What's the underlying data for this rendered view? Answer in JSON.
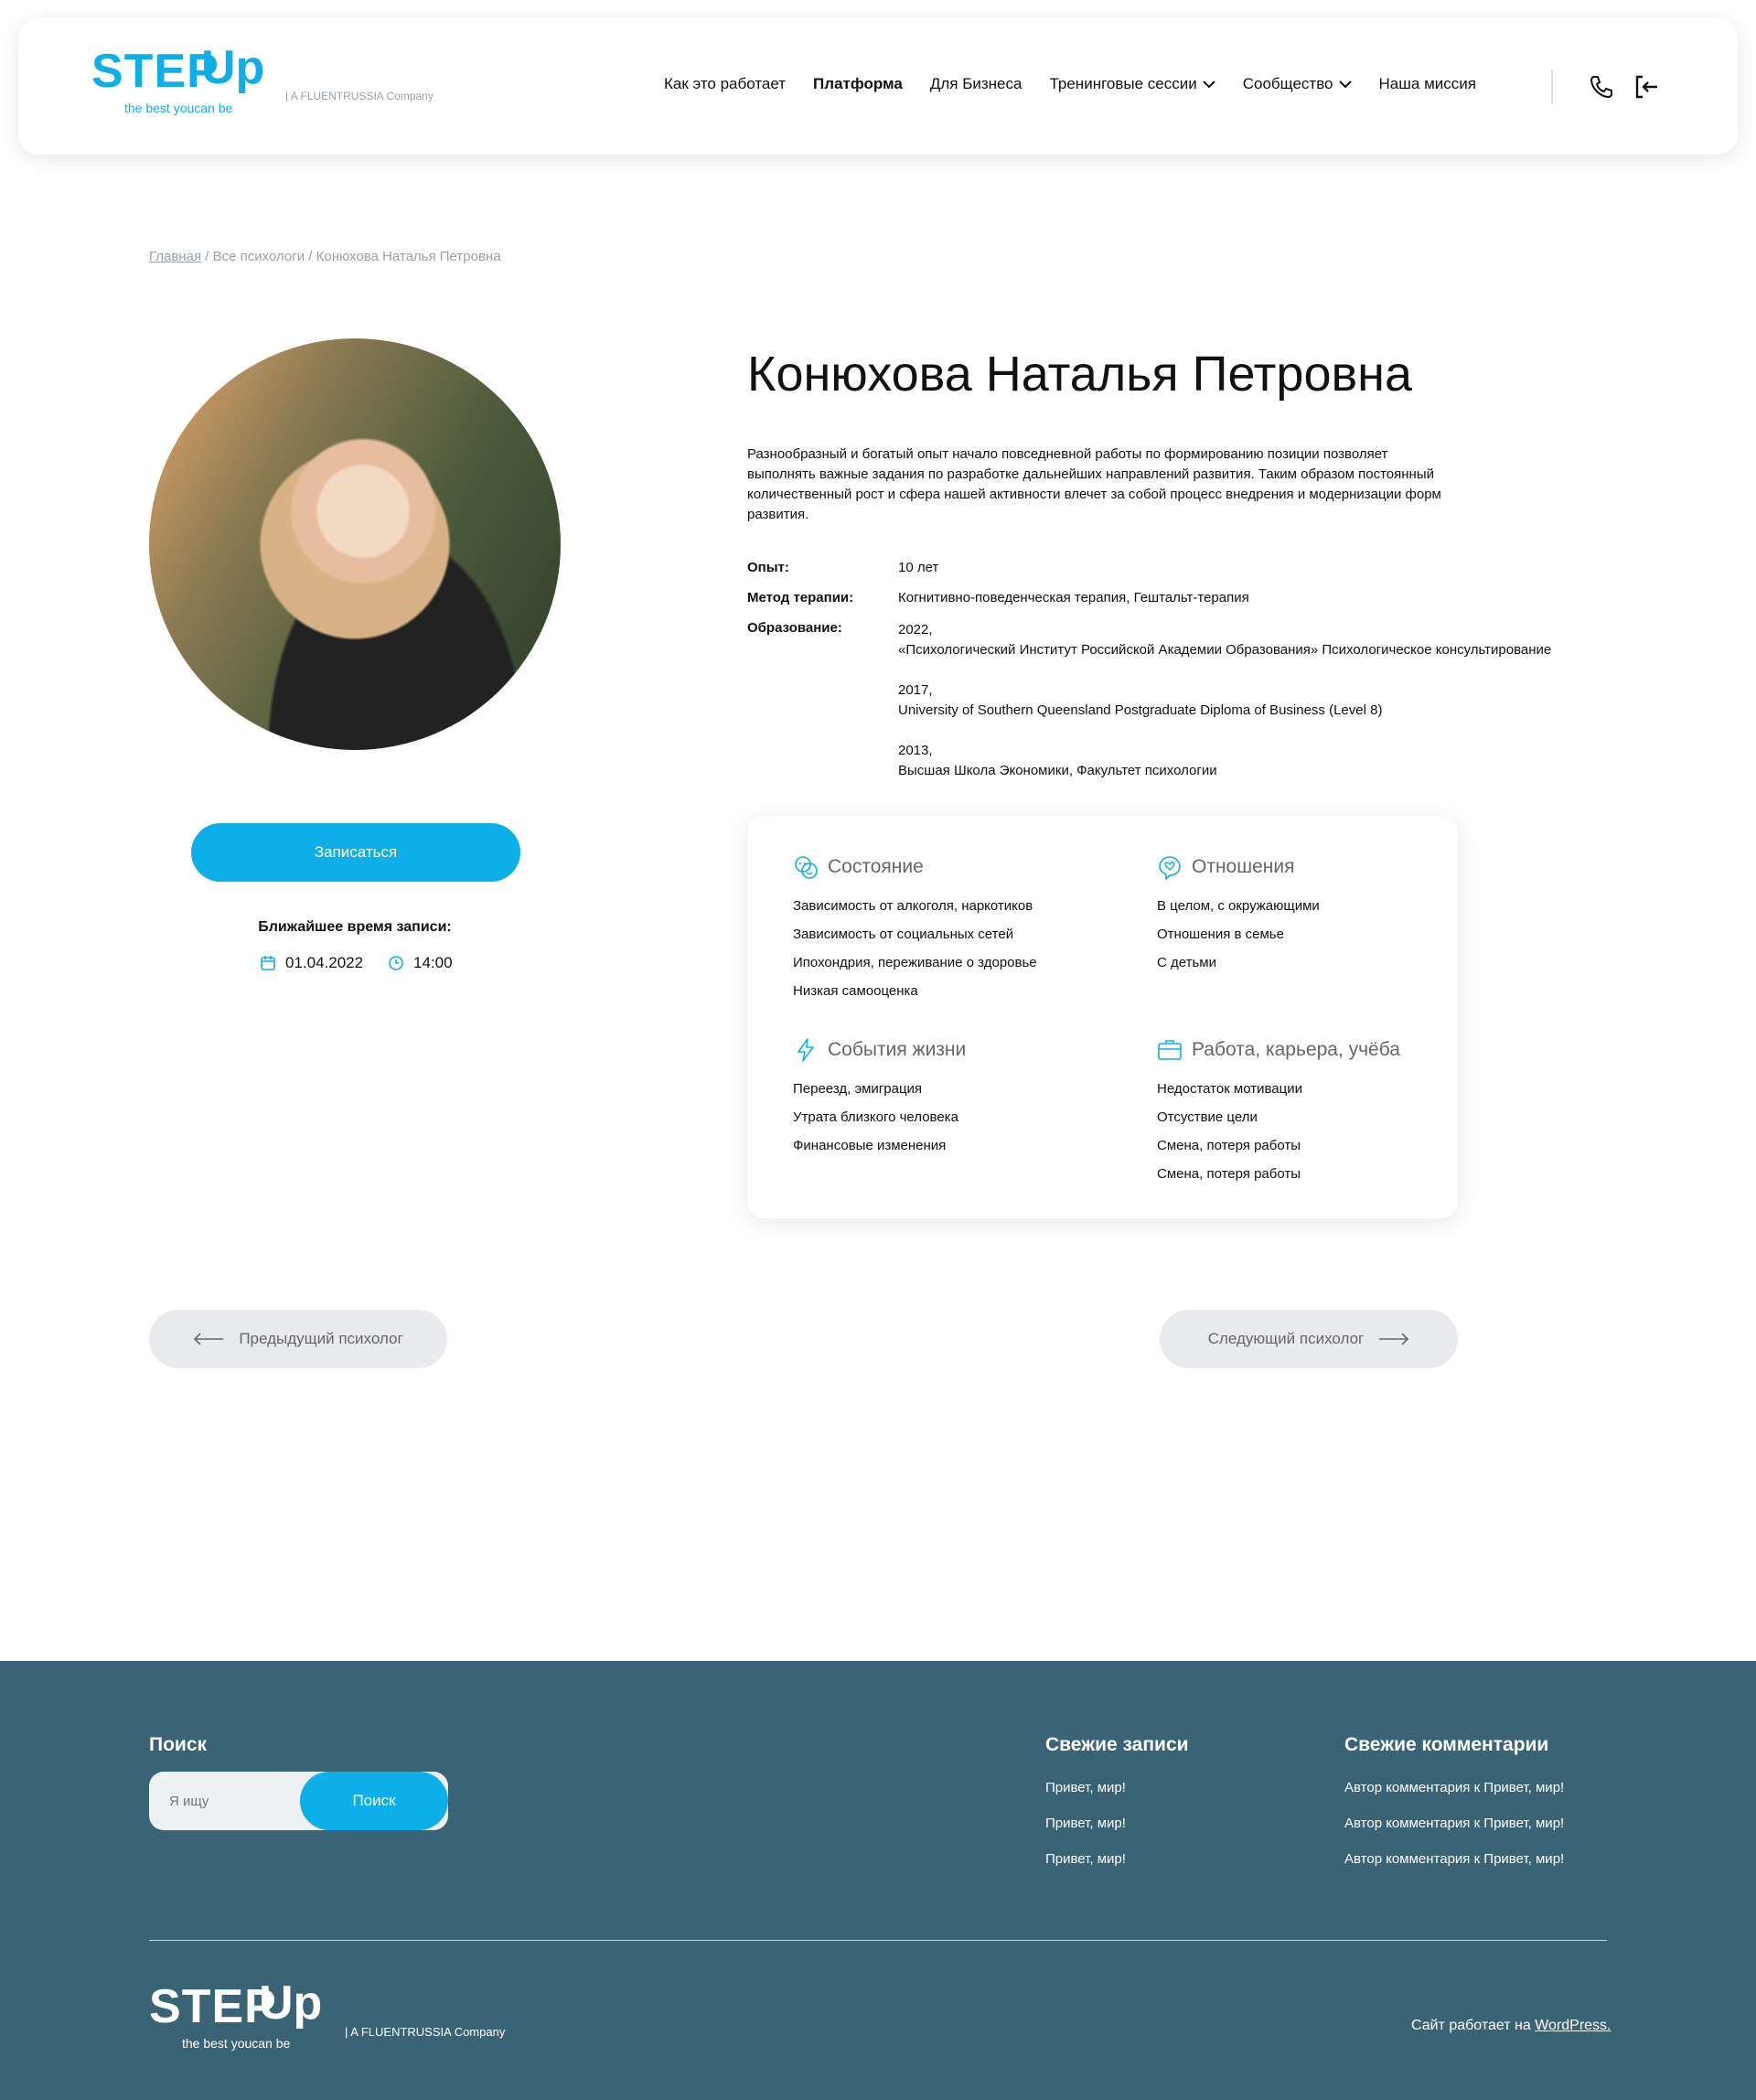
{
  "header": {
    "logo_main": "STEP",
    "logo_up": "Up",
    "logo_tagline": "the best youcan be",
    "logo_company": "| A FLUENTRUSSIA Company",
    "nav": [
      {
        "label": "Как это работает",
        "bold": false
      },
      {
        "label": "Платформа",
        "bold": true
      },
      {
        "label": "Для Бизнеса",
        "bold": false
      },
      {
        "label": "Тренинговые сессии",
        "bold": false,
        "dropdown": true
      },
      {
        "label": "Сообщество",
        "bold": false,
        "dropdown": true
      },
      {
        "label": "Наша миссия",
        "bold": false
      }
    ]
  },
  "breadcrumb": {
    "home": "Главная",
    "sep": " / ",
    "all": "Все психологи",
    "current": "Конюхова Наталья Петровна"
  },
  "profile": {
    "name": "Конюхова Наталья Петровна",
    "bio": "Разнообразный и богатый опыт начало повседневной работы по формированию позиции позволяет выполнять важные задания по разработке дальнейших направлений развития. Таким образом постоянный количественный рост и сфера нашей активности влечет за собой процесс внедрения и модернизации форм развития.",
    "experience_label": "Опыт:",
    "experience": "10 лет",
    "method_label": "Метод терапии:",
    "method": "Когнитивно-поведенческая терапия, Гештальт-терапия",
    "education_label": "Образование:",
    "education": [
      {
        "year": "2022,",
        "text": "«Психологический Институт Российской Академии Образования» Психологическое консультирование"
      },
      {
        "year": "2017,",
        "text": "University of Southern Queensland Postgraduate Diploma of Business (Level 8)"
      },
      {
        "year": "2013,",
        "text": "Высшая Школа Экономики, Факультет психологии"
      }
    ],
    "book_button": "Записаться",
    "nearest_label": "Ближайшее время записи:",
    "nearest_date": "01.04.2022",
    "nearest_time": "14:00"
  },
  "conditions": {
    "state": {
      "title": "Состояние",
      "icon": "faces-icon",
      "items": [
        "Зависимость от алкоголя, наркотиков",
        "Зависимость от социальных сетей",
        "Ипохондрия, переживание о здоровье",
        "Низкая самооценка"
      ]
    },
    "relations": {
      "title": "Отношения",
      "icon": "heart-bubble-icon",
      "items": [
        "В целом, с окружающими",
        "Отношения в семье",
        "С детьми"
      ]
    },
    "events": {
      "title": "События жизни",
      "icon": "lightning-icon",
      "items": [
        "Переезд, эмиграция",
        "Утрата близкого человека",
        "Финансовые изменения"
      ]
    },
    "work": {
      "title": "Работа, карьера, учёба",
      "icon": "briefcase-icon",
      "items": [
        "Недостаток мотивации",
        "Отсуствие цели",
        "Смена, потеря работы",
        "Смена, потеря работы"
      ]
    }
  },
  "pager": {
    "prev": "Предыдущий психолог",
    "next": "Следующий психолог"
  },
  "footer": {
    "search_title": "Поиск",
    "search_placeholder": "Я ищу",
    "search_button": "Поиск",
    "recent_posts_title": "Свежие записи",
    "recent_posts": [
      "Привет, мир!",
      "Привет, мир!",
      "Привет, мир!"
    ],
    "recent_comments_title": "Свежие комментарии",
    "recent_comments": [
      "Автор комментария к Привет, мир!",
      "Автор комментария к Привет, мир!",
      "Автор комментария к Привет, мир!"
    ],
    "powered_text": "Сайт работает на ",
    "powered_link": "WordPress."
  },
  "colors": {
    "accent": "#0eaee8",
    "footer_bg": "#3a6475",
    "pill_bg": "#e8eaed"
  }
}
